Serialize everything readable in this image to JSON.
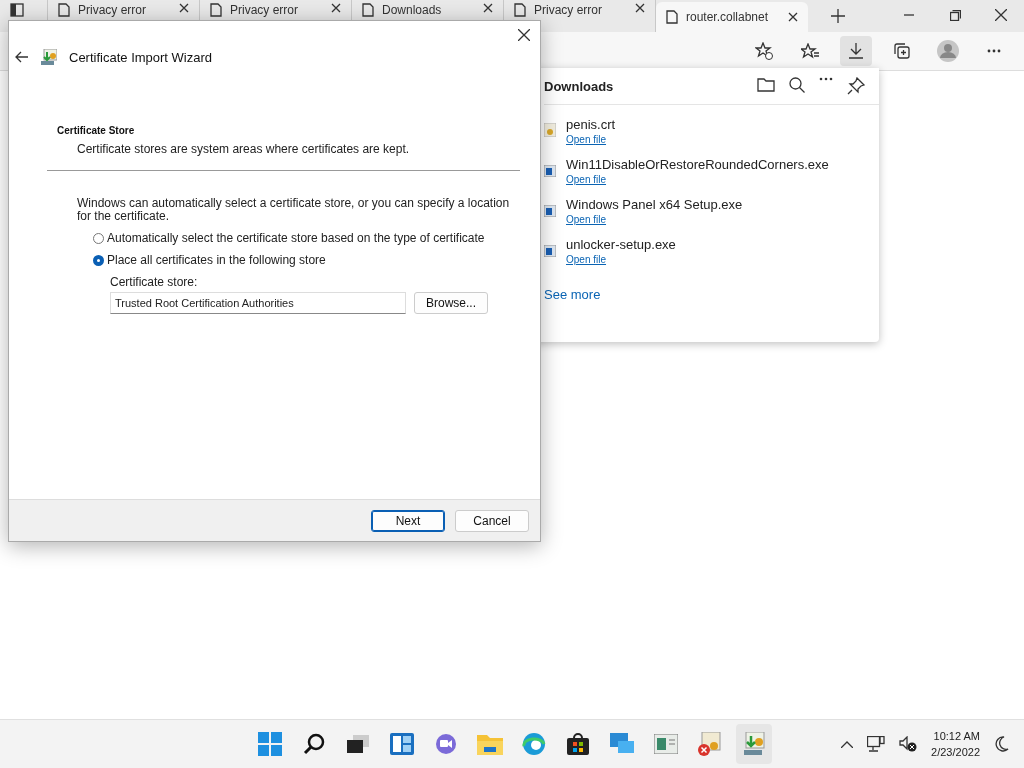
{
  "browser": {
    "tabs": [
      {
        "label": "Privacy error",
        "selected": false
      },
      {
        "label": "Privacy error",
        "selected": false
      },
      {
        "label": "Downloads",
        "selected": false
      },
      {
        "label": "Privacy error",
        "selected": false
      },
      {
        "label": "router.collabnet",
        "selected": true
      }
    ]
  },
  "downloads": {
    "title": "Downloads",
    "items": [
      {
        "name": "penis.crt",
        "link": "Open file",
        "kind": "certificate"
      },
      {
        "name": "Win11DisableOrRestoreRoundedCorners.exe",
        "link": "Open file",
        "kind": "app"
      },
      {
        "name": "Windows Panel x64 Setup.exe",
        "link": "Open file",
        "kind": "app"
      },
      {
        "name": "unlocker-setup.exe",
        "link": "Open file",
        "kind": "app"
      }
    ],
    "see_more": "See more"
  },
  "dialog": {
    "title": "Certificate Import Wizard",
    "heading": "Certificate Store",
    "subheading": "Certificate stores are system areas where certificates are kept.",
    "intro": "Windows can automatically select a certificate store, or you can specify a location for the certificate.",
    "options": [
      {
        "label": "Automatically select the certificate store based on the type of certificate",
        "selected": false
      },
      {
        "label": "Place all certificates in the following store",
        "selected": true
      }
    ],
    "store_label": "Certificate store:",
    "store_value": "Trusted Root Certification Authorities",
    "browse": "Browse...",
    "buttons": [
      {
        "label": "Next",
        "default": true
      },
      {
        "label": "Cancel",
        "default": false
      }
    ]
  },
  "taskbar": {
    "time": "10:12 AM",
    "date": "2/23/2022"
  }
}
